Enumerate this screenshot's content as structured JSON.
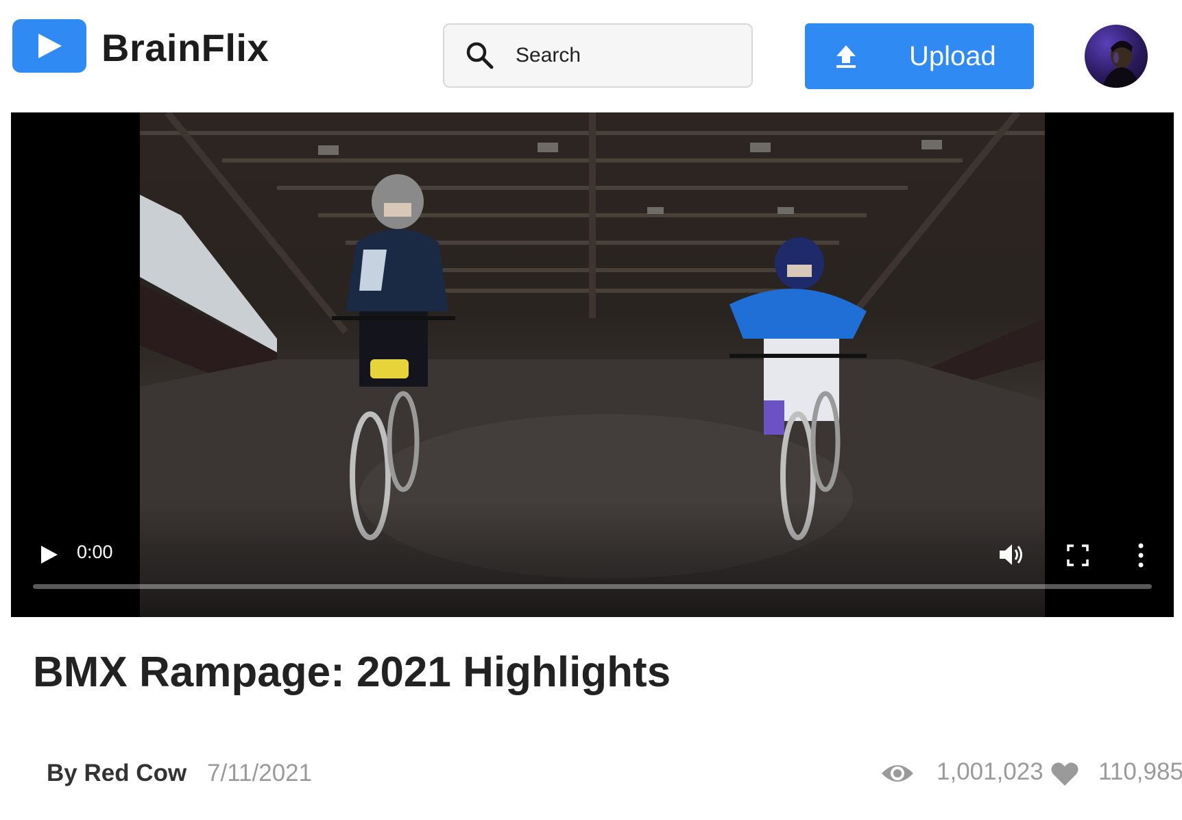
{
  "header": {
    "brand": "BrainFlix",
    "search_placeholder": "Search",
    "upload_label": "Upload"
  },
  "player": {
    "current_time": "0:00",
    "progress": 0
  },
  "video": {
    "title": "BMX Rampage: 2021 Highlights",
    "channel": "By Red Cow",
    "date": "7/11/2021",
    "views": "1,001,023",
    "likes": "110,985"
  },
  "colors": {
    "accent": "#2f8bf3",
    "muted_text": "#9a9a9a",
    "title_text": "#222222"
  },
  "icons": {
    "logo": "play-icon",
    "search": "search-icon",
    "upload": "upload-icon",
    "play": "play-icon",
    "volume": "volume-icon",
    "fullscreen": "fullscreen-icon",
    "more": "more-vertical-icon",
    "views": "eye-icon",
    "likes": "heart-icon"
  }
}
